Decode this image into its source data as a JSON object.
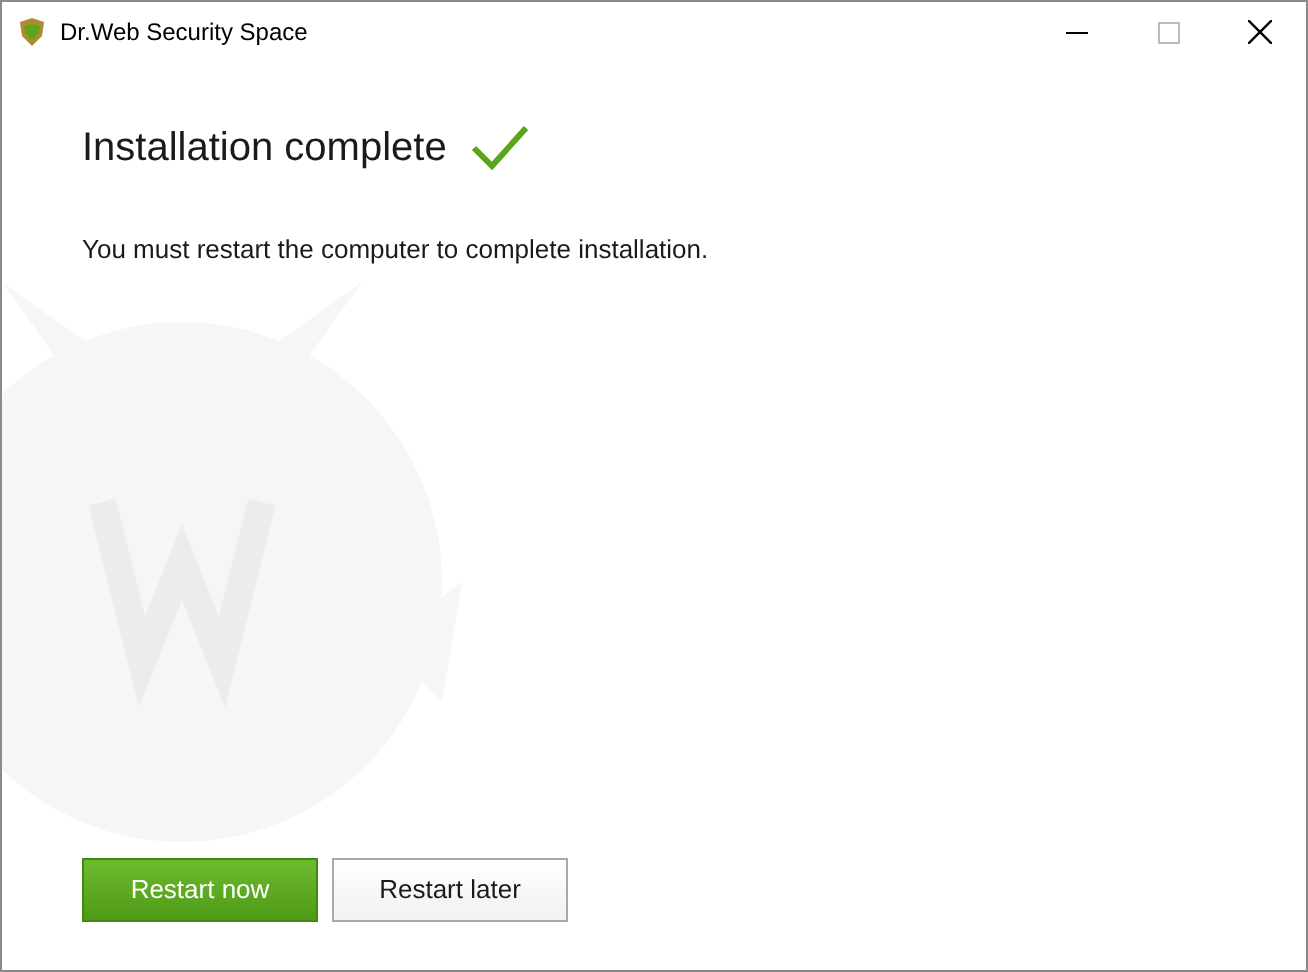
{
  "window": {
    "title": "Dr.Web Security Space"
  },
  "heading": "Installation complete",
  "message": "You must restart the computer to complete installation.",
  "buttons": [
    {
      "label": "Restart now",
      "kind": "primary"
    },
    {
      "label": "Restart later",
      "kind": "secondary"
    }
  ]
}
